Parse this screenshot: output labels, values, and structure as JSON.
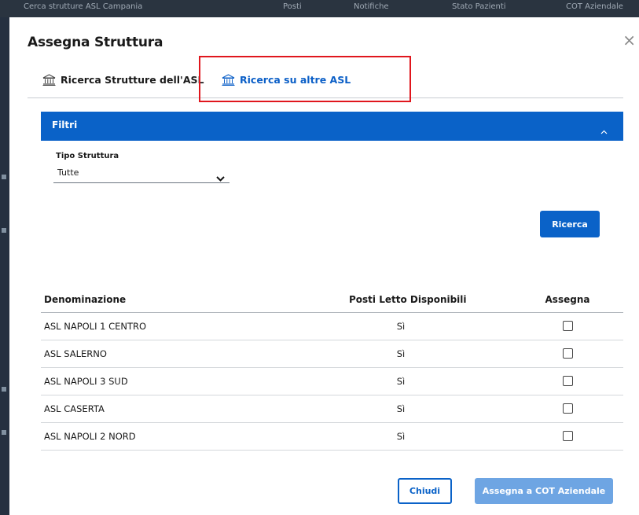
{
  "background": {
    "top_items": [
      "Cerca strutture ASL Campania",
      "Posti",
      "Notifiche",
      "Stato Pazienti",
      "COT Aziendale"
    ]
  },
  "modal": {
    "title": "Assegna Struttura",
    "close_label": "×",
    "tabs": [
      {
        "label": "Ricerca Strutture dell'ASL",
        "icon": "bank-building-icon",
        "active": false
      },
      {
        "label": "Ricerca su altre ASL",
        "icon": "bank-building-icon",
        "active": true
      }
    ],
    "filters": {
      "header_label": "Filtri",
      "expanded": true,
      "tipo_struttura": {
        "label": "Tipo Struttura",
        "value": "Tutte"
      },
      "search_button": "Ricerca"
    },
    "table": {
      "columns": [
        "Denominazione",
        "Posti Letto Disponibili",
        "Assegna"
      ],
      "rows": [
        {
          "name": "ASL NAPOLI 1 CENTRO",
          "posti": "Sì",
          "assegna": false
        },
        {
          "name": "ASL SALERNO",
          "posti": "Sì",
          "assegna": false
        },
        {
          "name": "ASL NAPOLI 3 SUD",
          "posti": "Sì",
          "assegna": false
        },
        {
          "name": "ASL CASERTA",
          "posti": "Sì",
          "assegna": false
        },
        {
          "name": "ASL NAPOLI 2 NORD",
          "posti": "Sì",
          "assegna": false
        }
      ]
    },
    "footer": {
      "close_button": "Chiudi",
      "assign_button": "Assegna a COT Aziendale"
    }
  },
  "colors": {
    "primary": "#0a62c8",
    "primary_disabled": "#6ea5e3",
    "highlight": "#e0161d"
  }
}
